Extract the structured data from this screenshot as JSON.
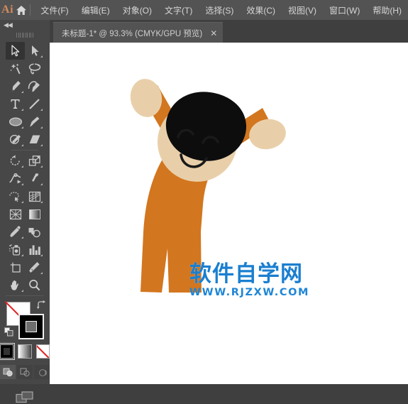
{
  "app": {
    "logo_text": "Ai",
    "home_icon": "home-icon"
  },
  "menubar": {
    "items": [
      {
        "label": "文件(F)",
        "name": "menu-file"
      },
      {
        "label": "编辑(E)",
        "name": "menu-edit"
      },
      {
        "label": "对象(O)",
        "name": "menu-object"
      },
      {
        "label": "文字(T)",
        "name": "menu-type"
      },
      {
        "label": "选择(S)",
        "name": "menu-select"
      },
      {
        "label": "效果(C)",
        "name": "menu-effect"
      },
      {
        "label": "视图(V)",
        "name": "menu-view"
      },
      {
        "label": "窗口(W)",
        "name": "menu-window"
      },
      {
        "label": "帮助(H)",
        "name": "menu-help"
      }
    ]
  },
  "tabbar": {
    "document_title": "未标题-1* @ 93.3% (CMYK/GPU 预览)",
    "close_label": "✕"
  },
  "toolbar": {
    "collapse_label": "◀◀",
    "tools": [
      {
        "name": "selection-tool",
        "label": "选择工具",
        "active": true,
        "corner": false
      },
      {
        "name": "direct-selection-tool",
        "label": "直接选择工具",
        "active": false,
        "corner": true
      },
      {
        "name": "magic-wand-tool",
        "label": "魔棒工具",
        "active": false,
        "corner": false
      },
      {
        "name": "lasso-tool",
        "label": "套索工具",
        "active": false,
        "corner": false
      },
      {
        "name": "pen-tool",
        "label": "钢笔工具",
        "active": false,
        "corner": true
      },
      {
        "name": "curvature-tool",
        "label": "曲率工具",
        "active": false,
        "corner": false
      },
      {
        "name": "type-tool",
        "label": "文字工具",
        "active": false,
        "corner": true
      },
      {
        "name": "line-segment-tool",
        "label": "直线段工具",
        "active": false,
        "corner": true
      },
      {
        "name": "ellipse-tool",
        "label": "椭圆工具",
        "active": false,
        "corner": true
      },
      {
        "name": "paintbrush-tool",
        "label": "画笔工具",
        "active": false,
        "corner": true
      },
      {
        "name": "shaper-tool",
        "label": "Shaper 工具",
        "active": false,
        "corner": true
      },
      {
        "name": "eraser-tool",
        "label": "橡皮擦工具",
        "active": false,
        "corner": true
      },
      {
        "name": "rotate-tool",
        "label": "旋转工具",
        "active": false,
        "corner": true
      },
      {
        "name": "scale-tool",
        "label": "比例缩放工具",
        "active": false,
        "corner": true
      },
      {
        "name": "width-tool",
        "label": "宽度工具",
        "active": false,
        "corner": true
      },
      {
        "name": "free-transform-tool",
        "label": "自由变换工具",
        "active": false,
        "corner": true
      },
      {
        "name": "shape-builder-tool",
        "label": "形状生成器工具",
        "active": false,
        "corner": true
      },
      {
        "name": "perspective-grid-tool",
        "label": "透视网格工具",
        "active": false,
        "corner": true
      },
      {
        "name": "mesh-tool",
        "label": "网格工具",
        "active": false,
        "corner": false
      },
      {
        "name": "gradient-tool",
        "label": "渐变工具",
        "active": false,
        "corner": false
      },
      {
        "name": "eyedropper-tool",
        "label": "吸管工具",
        "active": false,
        "corner": true
      },
      {
        "name": "blend-tool",
        "label": "混合工具",
        "active": false,
        "corner": false
      },
      {
        "name": "symbol-sprayer-tool",
        "label": "符号喷枪工具",
        "active": false,
        "corner": true
      },
      {
        "name": "column-graph-tool",
        "label": "柱形图工具",
        "active": false,
        "corner": true
      },
      {
        "name": "artboard-tool",
        "label": "画板工具",
        "active": false,
        "corner": false
      },
      {
        "name": "slice-tool",
        "label": "切片工具",
        "active": false,
        "corner": true
      },
      {
        "name": "hand-tool",
        "label": "抓手工具",
        "active": false,
        "corner": true
      },
      {
        "name": "zoom-tool",
        "label": "缩放工具",
        "active": false,
        "corner": false
      }
    ],
    "fill_color": "#ffffff",
    "stroke_color": "#000000",
    "fill_label": "填色",
    "stroke_label": "描边",
    "swap_label": "互换填色和描边",
    "default_label": "默认填色和描边",
    "modes": [
      {
        "name": "color-mode-swatch",
        "label": "颜色",
        "selected": true
      },
      {
        "name": "gradient-mode-swatch",
        "label": "渐变",
        "selected": false
      },
      {
        "name": "none-mode-swatch",
        "label": "无",
        "selected": false
      }
    ],
    "draw_modes": [
      {
        "name": "draw-normal-button",
        "label": "正常绘图",
        "on": true
      },
      {
        "name": "draw-behind-button",
        "label": "背面绘图",
        "on": false
      },
      {
        "name": "draw-inside-button",
        "label": "内部绘图",
        "on": false
      }
    ],
    "screen_mode_label": "更改屏幕模式"
  },
  "canvas": {
    "zoom_level": "93.3%",
    "color_mode": "CMYK",
    "preview_mode": "GPU 预览",
    "artwork": {
      "name": "cheering-person-illustration",
      "body_color": "#d2761f",
      "skin_color": "#e9cfa9",
      "hair_color": "#0d0d0d",
      "outline_color": "#1a1a1a"
    },
    "watermark": {
      "cn_text": "软件自学网",
      "en_text": "WWW.RJZXW.COM",
      "color": "#1a7fd0"
    }
  }
}
